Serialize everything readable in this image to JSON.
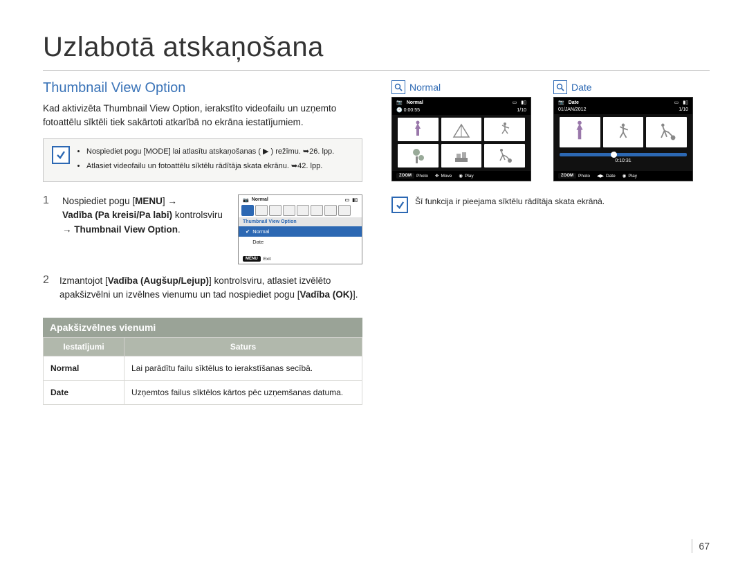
{
  "page_title": "Uzlabotā atskaņošana",
  "page_number": "67",
  "left": {
    "section_title": "Thumbnail View Option",
    "intro": "Kad aktivizēta Thumbnail View Option, ierakstīto videofailu un uzņemto fotoattēlu sīktēli tiek sakārtoti atkarībā no ekrāna iestatījumiem.",
    "hints": [
      "Nospiediet pogu [MODE] lai atlasītu atskaņošanas ( ▶ ) režīmu. ➥26. lpp.",
      "Atlasiet videofailu un fotoattēlu sīktēlu rādītāja skata ekrānu. ➥42. lpp."
    ],
    "steps": {
      "s1_num": "1",
      "s1_text_parts": {
        "a": "Nospiediet pogu [",
        "b": "MENU",
        "c": "] → ",
        "d": "Vadība (Pa kreisi/Pa labi)",
        "e": " kontrolsviru → ",
        "f": "Thumbnail View Option",
        "g": "."
      },
      "s2_num": "2",
      "s2_text_parts": {
        "a": "Izmantojot [",
        "b": "Vadība (Augšup/Lejup)",
        "c": "] kontrolsviru, atlasiet izvēlēto apakšizvēlni un izvēlnes vienumu un tad nospiediet pogu [",
        "d": "Vadība (OK)",
        "e": "]."
      }
    },
    "lcd": {
      "hdr_label": "Normal",
      "title": "Thumbnail View Option",
      "opt1": "Normal",
      "opt2": "Date",
      "menu_badge": "MENU",
      "exit": "Exit"
    },
    "submenu_header": "Apakšizvēlnes vienumi",
    "table": {
      "col1": "Iestatījumi",
      "col2": "Saturs",
      "rows": [
        {
          "name": "Normal",
          "desc": "Lai parādītu failu sīktēlus to ierakstīšanas secībā."
        },
        {
          "name": "Date",
          "desc": "Uzņemtos failus sīktēlos kārtos pēc uzņemšanas datuma."
        }
      ]
    }
  },
  "right": {
    "boxes": [
      {
        "title": "Normal",
        "tag": "Normal",
        "sub_left": "0:00:55",
        "sub_right": "1/10",
        "foot": {
          "zoom": "ZOOM",
          "photo": "Photo",
          "move": "Move",
          "play": "Play"
        }
      },
      {
        "title": "Date",
        "tag": "Date",
        "sub_left": "01/JAN/2012",
        "sub_right": "1/10",
        "time": "0:10:31",
        "foot": {
          "zoom": "ZOOM",
          "photo": "Photo",
          "date": "Date",
          "play": "Play"
        }
      }
    ],
    "note": "Šī funkcija ir pieejama sīktēlu rādītāja skata ekrānā."
  }
}
